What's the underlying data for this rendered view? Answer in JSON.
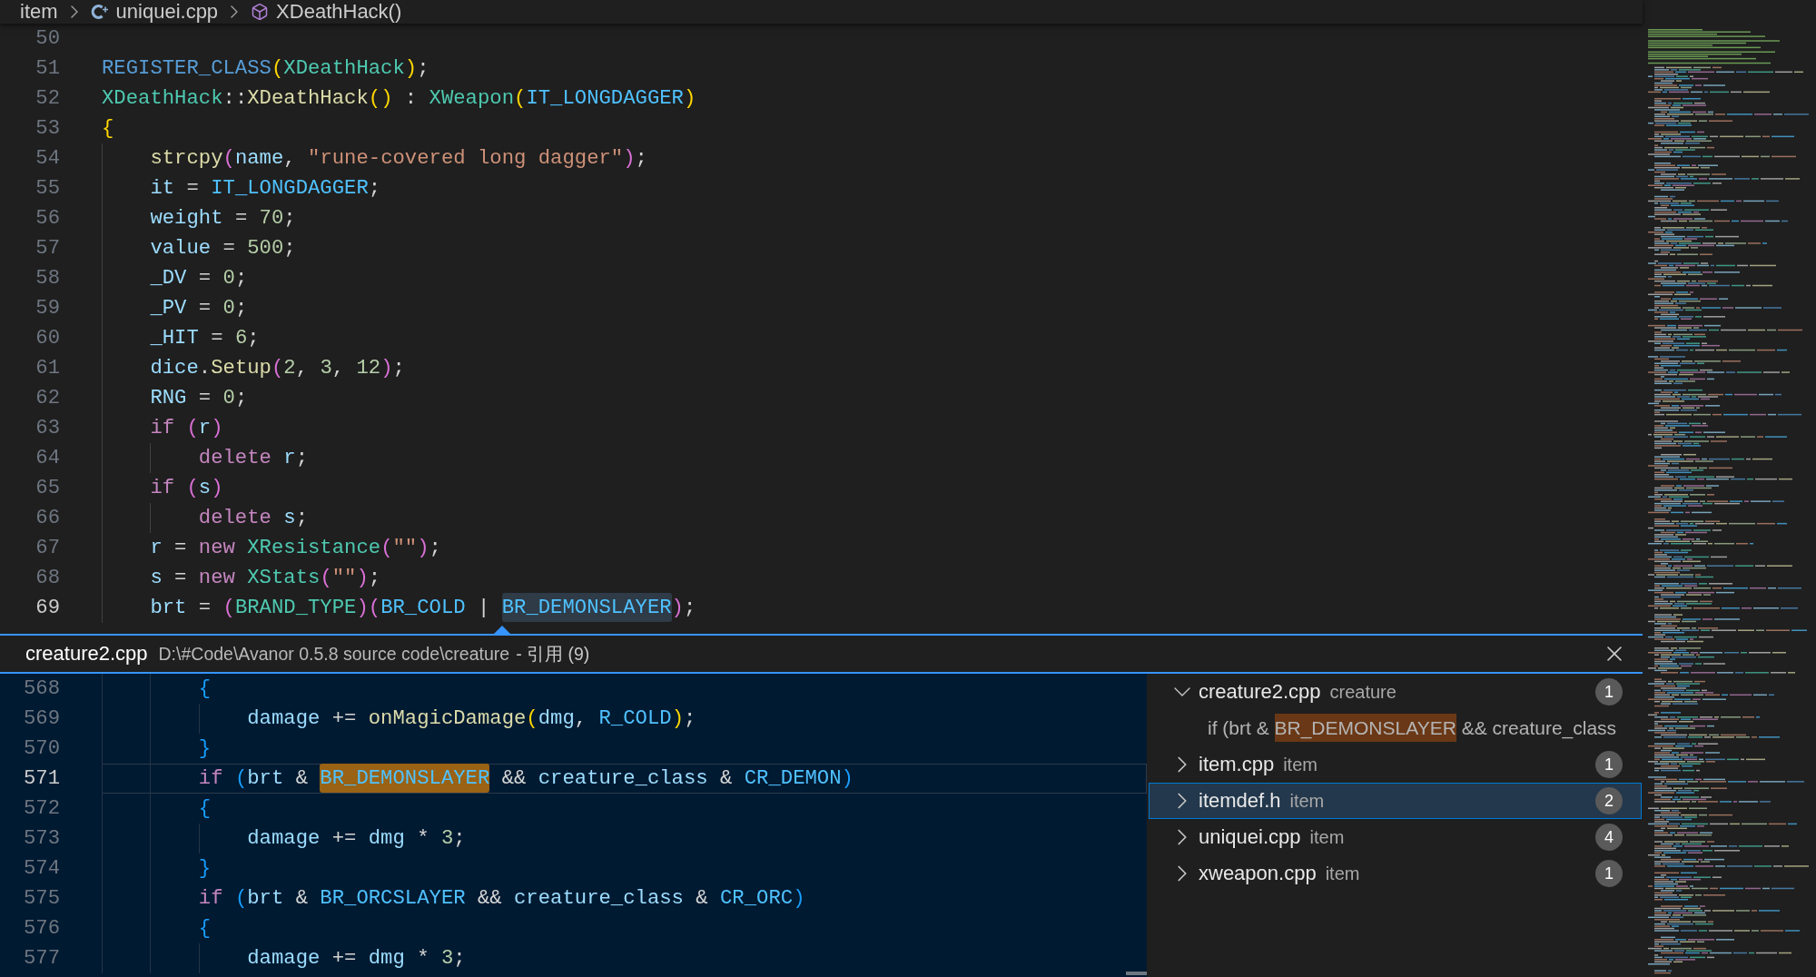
{
  "breadcrumb": [
    {
      "kind": "folder",
      "label": "item"
    },
    {
      "kind": "file",
      "label": "uniquei.cpp"
    },
    {
      "kind": "symbol",
      "label": "XDeathHack()"
    }
  ],
  "editor": {
    "lines": [
      {
        "number": "50",
        "current": false
      },
      {
        "number": "51",
        "current": false,
        "tokens": [
          {
            "text": "REGISTER_CLASS",
            "kind": "macro"
          },
          {
            "text": "(",
            "kind": "paren1"
          },
          {
            "text": "XDeathHack",
            "kind": "type"
          },
          {
            "text": ")",
            "kind": "paren1"
          },
          {
            "text": ";",
            "kind": "punct"
          }
        ]
      },
      {
        "number": "52",
        "current": false,
        "tokens": [
          {
            "text": "XDeathHack",
            "kind": "type"
          },
          {
            "text": "::",
            "kind": "punct"
          },
          {
            "text": "XDeathHack",
            "kind": "function"
          },
          {
            "text": "()",
            "kind": "paren1"
          },
          {
            "text": " : ",
            "kind": "punct"
          },
          {
            "text": "XWeapon",
            "kind": "type"
          },
          {
            "text": "(",
            "kind": "paren1"
          },
          {
            "text": "IT_LONGDAGGER",
            "kind": "constant"
          },
          {
            "text": ")",
            "kind": "paren1"
          }
        ]
      },
      {
        "number": "53",
        "current": false,
        "tokens": [
          {
            "text": "{",
            "kind": "paren1"
          }
        ],
        "children": [
          {
            "number": "54",
            "current": false,
            "tokens": [
              {
                "text": "strcpy",
                "kind": "function"
              },
              {
                "text": "(",
                "kind": "paren2"
              },
              {
                "text": "name",
                "kind": "variable"
              },
              {
                "text": ", ",
                "kind": "punct"
              },
              {
                "text": "\"rune-covered long dagger\"",
                "kind": "string"
              },
              {
                "text": ")",
                "kind": "paren2"
              },
              {
                "text": ";",
                "kind": "punct"
              }
            ]
          },
          {
            "number": "55",
            "current": false,
            "tokens": [
              {
                "text": "it",
                "kind": "variable"
              },
              {
                "text": " = ",
                "kind": "punct"
              },
              {
                "text": "IT_LONGDAGGER",
                "kind": "constant"
              },
              {
                "text": ";",
                "kind": "punct"
              }
            ]
          },
          {
            "number": "56",
            "current": false,
            "tokens": [
              {
                "text": "weight",
                "kind": "variable"
              },
              {
                "text": " = ",
                "kind": "punct"
              },
              {
                "text": "70",
                "kind": "number"
              },
              {
                "text": ";",
                "kind": "punct"
              }
            ]
          },
          {
            "number": "57",
            "current": false,
            "tokens": [
              {
                "text": "value",
                "kind": "variable"
              },
              {
                "text": " = ",
                "kind": "punct"
              },
              {
                "text": "500",
                "kind": "number"
              },
              {
                "text": ";",
                "kind": "punct"
              }
            ]
          },
          {
            "number": "58",
            "current": false,
            "tokens": [
              {
                "text": "_DV",
                "kind": "variable"
              },
              {
                "text": " = ",
                "kind": "punct"
              },
              {
                "text": "0",
                "kind": "number"
              },
              {
                "text": ";",
                "kind": "punct"
              }
            ]
          },
          {
            "number": "59",
            "current": false,
            "tokens": [
              {
                "text": "_PV",
                "kind": "variable"
              },
              {
                "text": " = ",
                "kind": "punct"
              },
              {
                "text": "0",
                "kind": "number"
              },
              {
                "text": ";",
                "kind": "punct"
              }
            ]
          },
          {
            "number": "60",
            "current": false,
            "tokens": [
              {
                "text": "_HIT",
                "kind": "variable"
              },
              {
                "text": " = ",
                "kind": "punct"
              },
              {
                "text": "6",
                "kind": "number"
              },
              {
                "text": ";",
                "kind": "punct"
              }
            ]
          },
          {
            "number": "61",
            "current": false,
            "tokens": [
              {
                "text": "dice",
                "kind": "variable"
              },
              {
                "text": ".",
                "kind": "punct"
              },
              {
                "text": "Setup",
                "kind": "function"
              },
              {
                "text": "(",
                "kind": "paren2"
              },
              {
                "text": "2",
                "kind": "number"
              },
              {
                "text": ", ",
                "kind": "punct"
              },
              {
                "text": "3",
                "kind": "number"
              },
              {
                "text": ", ",
                "kind": "punct"
              },
              {
                "text": "12",
                "kind": "number"
              },
              {
                "text": ")",
                "kind": "paren2"
              },
              {
                "text": ";",
                "kind": "punct"
              }
            ]
          },
          {
            "number": "62",
            "current": false,
            "tokens": [
              {
                "text": "RNG",
                "kind": "variable"
              },
              {
                "text": " = ",
                "kind": "punct"
              },
              {
                "text": "0",
                "kind": "number"
              },
              {
                "text": ";",
                "kind": "punct"
              }
            ]
          },
          {
            "number": "63",
            "current": false,
            "tokens": [
              {
                "text": "if ",
                "kind": "keyword"
              },
              {
                "text": "(",
                "kind": "paren2"
              },
              {
                "text": "r",
                "kind": "variable"
              },
              {
                "text": ")",
                "kind": "paren2"
              }
            ],
            "children": [
              {
                "number": "64",
                "current": false,
                "tokens": [
                  {
                    "text": "delete ",
                    "kind": "keyword"
                  },
                  {
                    "text": "r",
                    "kind": "variable"
                  },
                  {
                    "text": ";",
                    "kind": "punct"
                  }
                ]
              }
            ]
          },
          {
            "number": "65",
            "current": false,
            "tokens": [
              {
                "text": "if ",
                "kind": "keyword"
              },
              {
                "text": "(",
                "kind": "paren2"
              },
              {
                "text": "s",
                "kind": "variable"
              },
              {
                "text": ")",
                "kind": "paren2"
              }
            ],
            "children": [
              {
                "number": "66",
                "current": false,
                "tokens": [
                  {
                    "text": "delete ",
                    "kind": "keyword"
                  },
                  {
                    "text": "s",
                    "kind": "variable"
                  },
                  {
                    "text": ";",
                    "kind": "punct"
                  }
                ]
              }
            ]
          },
          {
            "number": "67",
            "current": false,
            "tokens": [
              {
                "text": "r",
                "kind": "variable"
              },
              {
                "text": " = ",
                "kind": "punct"
              },
              {
                "text": "new ",
                "kind": "keyword"
              },
              {
                "text": "XResistance",
                "kind": "type"
              },
              {
                "text": "(",
                "kind": "paren2"
              },
              {
                "text": "\"\"",
                "kind": "string"
              },
              {
                "text": ")",
                "kind": "paren2"
              },
              {
                "text": ";",
                "kind": "punct"
              }
            ]
          },
          {
            "number": "68",
            "current": false,
            "tokens": [
              {
                "text": "s",
                "kind": "variable"
              },
              {
                "text": " = ",
                "kind": "punct"
              },
              {
                "text": "new ",
                "kind": "keyword"
              },
              {
                "text": "XStats",
                "kind": "type"
              },
              {
                "text": "(",
                "kind": "paren2"
              },
              {
                "text": "\"\"",
                "kind": "string"
              },
              {
                "text": ")",
                "kind": "paren2"
              },
              {
                "text": ";",
                "kind": "punct"
              }
            ]
          },
          {
            "number": "69",
            "current": true,
            "tokens": [
              {
                "text": "brt",
                "kind": "variable"
              },
              {
                "text": " = ",
                "kind": "punct"
              },
              {
                "text": "(",
                "kind": "paren2"
              },
              {
                "text": "BRAND_TYPE",
                "kind": "type"
              },
              {
                "text": ")",
                "kind": "paren2"
              },
              {
                "text": "(",
                "kind": "paren2"
              },
              {
                "text": "BR_COLD",
                "kind": "constant"
              },
              {
                "text": " | ",
                "kind": "punct"
              },
              {
                "text": "BR_DEMONSLAYER",
                "kind": "symbol-highlight"
              },
              {
                "text": ")",
                "kind": "paren2"
              },
              {
                "text": ";",
                "kind": "punct"
              }
            ]
          }
        ]
      }
    ]
  },
  "peek": {
    "file": "creature2.cpp",
    "path": "D:\\#Code\\Avanor 0.5.8 source code\\creature",
    "summary": "- 引用 (9)",
    "lines": [
      {
        "number": "568",
        "current": false,
        "tokens": [
          {
            "text": "{",
            "kind": "paren3"
          }
        ],
        "children": [
          {
            "number": "569",
            "current": false,
            "tokens": [
              {
                "text": "damage",
                "kind": "variable"
              },
              {
                "text": " += ",
                "kind": "punct"
              },
              {
                "text": "onMagicDamage",
                "kind": "function"
              },
              {
                "text": "(",
                "kind": "paren1"
              },
              {
                "text": "dmg",
                "kind": "variable"
              },
              {
                "text": ", ",
                "kind": "punct"
              },
              {
                "text": "R_COLD",
                "kind": "constant"
              },
              {
                "text": ")",
                "kind": "paren1"
              },
              {
                "text": ";",
                "kind": "punct"
              }
            ]
          }
        ]
      },
      {
        "number": "570",
        "current": false,
        "tokens": [
          {
            "text": "}",
            "kind": "paren3"
          }
        ]
      },
      {
        "number": "571",
        "current": true,
        "tokens": [
          {
            "text": "if ",
            "kind": "keyword"
          },
          {
            "text": "(",
            "kind": "paren3"
          },
          {
            "text": "brt",
            "kind": "variable"
          },
          {
            "text": " & ",
            "kind": "punct"
          },
          {
            "text": "BR_DEMONSLAYER",
            "kind": "match-highlight"
          },
          {
            "text": " && ",
            "kind": "punct"
          },
          {
            "text": "creature_class",
            "kind": "variable"
          },
          {
            "text": " & ",
            "kind": "punct"
          },
          {
            "text": "CR_DEMON",
            "kind": "constant"
          },
          {
            "text": ")",
            "kind": "paren3"
          }
        ]
      },
      {
        "number": "572",
        "current": false,
        "tokens": [
          {
            "text": "{",
            "kind": "paren3"
          }
        ],
        "children": [
          {
            "number": "573",
            "current": false,
            "tokens": [
              {
                "text": "damage",
                "kind": "variable"
              },
              {
                "text": " += ",
                "kind": "punct"
              },
              {
                "text": "dmg",
                "kind": "variable"
              },
              {
                "text": " * ",
                "kind": "punct"
              },
              {
                "text": "3",
                "kind": "number"
              },
              {
                "text": ";",
                "kind": "punct"
              }
            ]
          }
        ]
      },
      {
        "number": "574",
        "current": false,
        "tokens": [
          {
            "text": "}",
            "kind": "paren3"
          }
        ]
      },
      {
        "number": "575",
        "current": false,
        "tokens": [
          {
            "text": "if ",
            "kind": "keyword"
          },
          {
            "text": "(",
            "kind": "paren3"
          },
          {
            "text": "brt",
            "kind": "variable"
          },
          {
            "text": " & ",
            "kind": "punct"
          },
          {
            "text": "BR_ORCSLAYER",
            "kind": "constant"
          },
          {
            "text": " && ",
            "kind": "punct"
          },
          {
            "text": "creature_class",
            "kind": "variable"
          },
          {
            "text": " & ",
            "kind": "punct"
          },
          {
            "text": "CR_ORC",
            "kind": "constant"
          },
          {
            "text": ")",
            "kind": "paren3"
          }
        ]
      },
      {
        "number": "576",
        "current": false,
        "tokens": [
          {
            "text": "{",
            "kind": "paren3"
          }
        ],
        "children": [
          {
            "number": "577",
            "current": false,
            "tokens": [
              {
                "text": "damage",
                "kind": "variable"
              },
              {
                "text": " += ",
                "kind": "punct"
              },
              {
                "text": "dmg",
                "kind": "variable"
              },
              {
                "text": " * ",
                "kind": "punct"
              },
              {
                "text": "3",
                "kind": "number"
              },
              {
                "text": ";",
                "kind": "punct"
              }
            ]
          }
        ]
      }
    ],
    "references": [
      {
        "file": "creature2.cpp",
        "folder": "creature",
        "count": "1",
        "expanded": true,
        "selected": false,
        "matches": [
          {
            "before": "if (brt & ",
            "match": "BR_DEMONSLAYER",
            "after": " && creature_class"
          }
        ]
      },
      {
        "file": "item.cpp",
        "folder": "item",
        "count": "1",
        "expanded": false,
        "selected": false
      },
      {
        "file": "itemdef.h",
        "folder": "item",
        "count": "2",
        "expanded": false,
        "selected": true
      },
      {
        "file": "uniquei.cpp",
        "folder": "item",
        "count": "4",
        "expanded": false,
        "selected": false
      },
      {
        "file": "xweapon.cpp",
        "folder": "item",
        "count": "1",
        "expanded": false,
        "selected": false
      }
    ]
  }
}
